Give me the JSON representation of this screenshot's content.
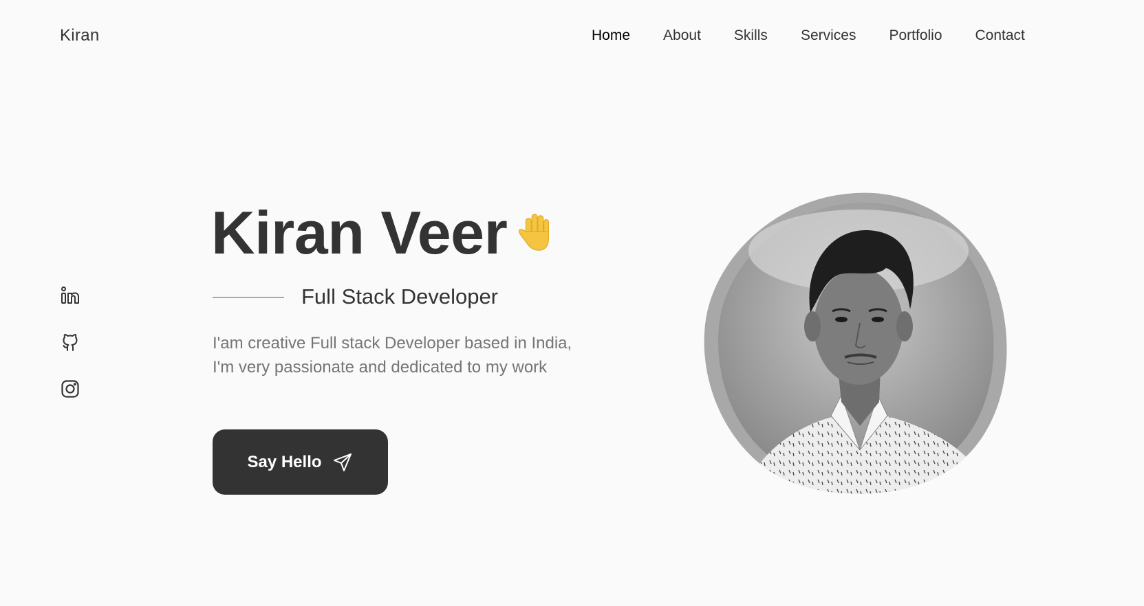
{
  "header": {
    "logo": "Kiran",
    "nav": [
      {
        "label": "Home",
        "active": true
      },
      {
        "label": "About"
      },
      {
        "label": "Skills"
      },
      {
        "label": "Services"
      },
      {
        "label": "Portfolio"
      },
      {
        "label": "Contact"
      }
    ]
  },
  "social": [
    {
      "icon": "linkedin-icon"
    },
    {
      "icon": "github-icon"
    },
    {
      "icon": "instagram-icon"
    }
  ],
  "hero": {
    "name": "Kiran Veer",
    "emoji_icon": "waving-hand-icon",
    "subtitle": "Full Stack Developer",
    "description_line1": "I'am creative Full stack Developer based in India,",
    "description_line2": "I'm very passionate and dedicated to my work",
    "cta_label": "Say Hello",
    "cta_icon": "send-icon"
  },
  "colors": {
    "background": "#fafafa",
    "text": "#333333",
    "muted_text": "#757575",
    "button": "#333333",
    "button_text": "#ffffff",
    "emoji": "#f5c542"
  }
}
